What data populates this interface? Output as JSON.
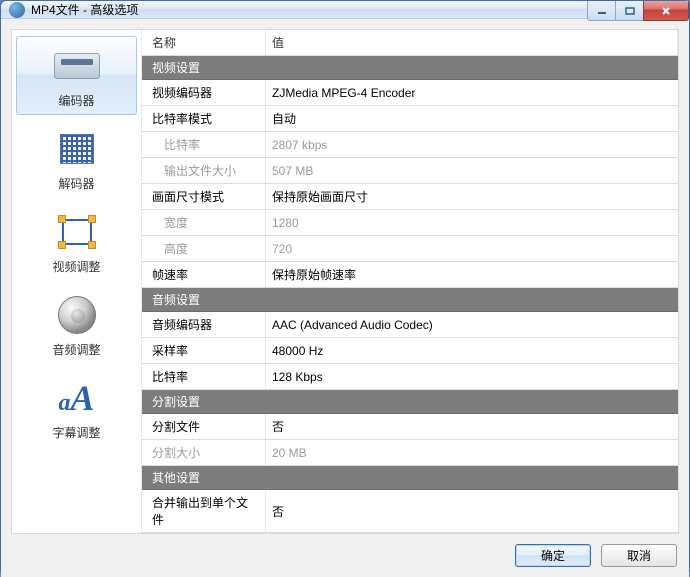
{
  "window": {
    "title": "MP4文件 - 高级选项"
  },
  "sidebar": {
    "items": [
      {
        "label": "编码器"
      },
      {
        "label": "解码器"
      },
      {
        "label": "视频调整"
      },
      {
        "label": "音频调整"
      },
      {
        "label": "字幕调整"
      }
    ]
  },
  "grid": {
    "header": {
      "name": "名称",
      "value": "值"
    },
    "sections": {
      "video": "视频设置",
      "audio": "音频设置",
      "split": "分割设置",
      "other": "其他设置"
    },
    "rows": {
      "video_encoder": {
        "name": "视频编码器",
        "value": "ZJMedia MPEG-4 Encoder"
      },
      "bitrate_mode": {
        "name": "比特率模式",
        "value": "自动"
      },
      "bitrate": {
        "name": "比特率",
        "value": "2807 kbps"
      },
      "out_size": {
        "name": "输出文件大小",
        "value": "507 MB"
      },
      "size_mode": {
        "name": "画面尺寸模式",
        "value": "保持原始画面尺寸"
      },
      "width": {
        "name": "宽度",
        "value": "1280"
      },
      "height": {
        "name": "高度",
        "value": "720"
      },
      "fps": {
        "name": "帧速率",
        "value": "保持原始帧速率"
      },
      "audio_encoder": {
        "name": "音频编码器",
        "value": "AAC (Advanced Audio Codec)"
      },
      "sample_rate": {
        "name": "采样率",
        "value": "48000 Hz"
      },
      "a_bitrate": {
        "name": "比特率",
        "value": "128 Kbps"
      },
      "split_file": {
        "name": "分割文件",
        "value": "否"
      },
      "split_size": {
        "name": "分割大小",
        "value": "20 MB"
      },
      "merge_single": {
        "name": "合并输出到单个文件",
        "value": "否"
      }
    }
  },
  "buttons": {
    "ok": "确定",
    "cancel": "取消"
  }
}
